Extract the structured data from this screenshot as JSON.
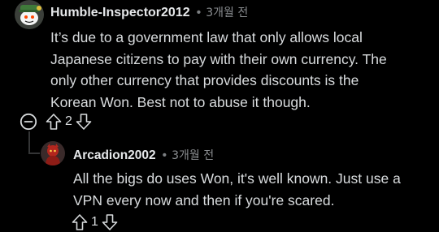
{
  "comments": [
    {
      "username": "Humble-Inspector2012",
      "separator": "•",
      "time": "3개월 전",
      "body": "It’s due to a government law that only allows local Japanese citizens to pay with their own currency. The only other currency that provides discounts is the Korean Won. Best not to abuse it though.",
      "votes": "2",
      "avatar_icon": "snoo-avatar-icon"
    },
    {
      "username": "Arcadion2002",
      "separator": "•",
      "time": "3개월 전",
      "body": "All the bigs do uses Won, it's well known. Just use a VPN every now and then if you're scared.",
      "votes": "1",
      "avatar_icon": "red-character-avatar-icon"
    }
  ],
  "icons": {
    "collapse": "collapse-thread-icon",
    "upvote": "upvote-arrow-icon",
    "downvote": "downvote-arrow-icon"
  },
  "colors": {
    "background": "#000000",
    "text": "#d7dadc",
    "meta": "#8a8d90",
    "thread_line": "#343536"
  }
}
